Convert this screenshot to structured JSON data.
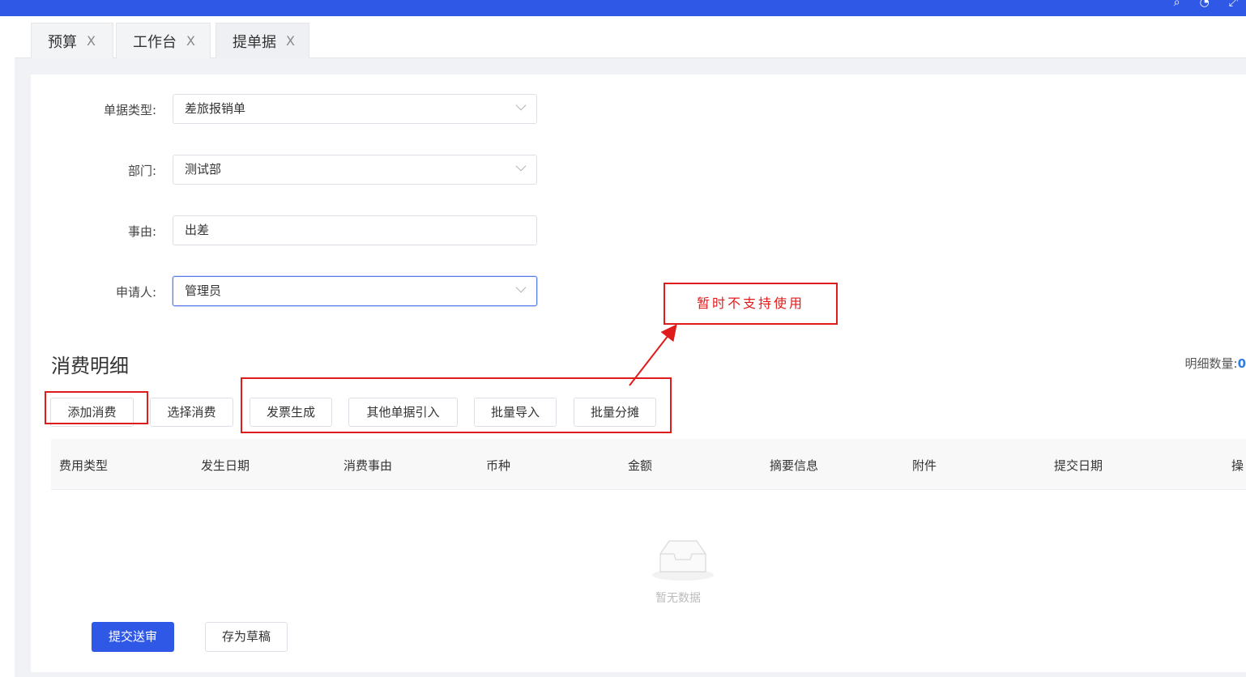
{
  "tabs": [
    {
      "label": "预算",
      "close": "X"
    },
    {
      "label": "工作台",
      "close": "X"
    },
    {
      "label": "提单据",
      "close": "X"
    }
  ],
  "form": {
    "doc_type": {
      "label": "单据类型:",
      "value": "差旅报销单"
    },
    "department": {
      "label": "部门:",
      "value": "测试部"
    },
    "reason": {
      "label": "事由:",
      "value": "出差"
    },
    "applicant": {
      "label": "申请人:",
      "value": "管理员"
    }
  },
  "section": {
    "title": "消费明细",
    "count_label": "明细数量:",
    "count_value": "0"
  },
  "actions": {
    "add": "添加消费",
    "select": "选择消费",
    "invoice": "发票生成",
    "import_other": "其他单据引入",
    "batch_import": "批量导入",
    "batch_allocate": "批量分摊"
  },
  "annotation": {
    "text": "暂时不支持使用",
    "color": "#e01b1b"
  },
  "table": {
    "columns": [
      "费用类型",
      "发生日期",
      "消费事由",
      "币种",
      "金额",
      "摘要信息",
      "附件",
      "提交日期",
      "操"
    ],
    "empty_text": "暂无数据"
  },
  "footer": {
    "submit": "提交送审",
    "draft": "存为草稿"
  },
  "colors": {
    "primary": "#2f58e6",
    "annotation": "#e01b1b",
    "count": "#2f7de6"
  }
}
